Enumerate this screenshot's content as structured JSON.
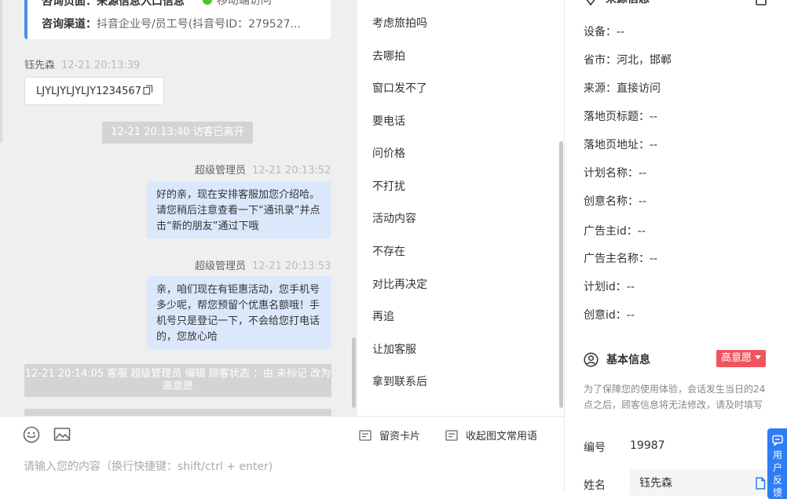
{
  "chat": {
    "info_card": {
      "row1_text": "咨询页面：来源信息入口信息",
      "status_text": "移动端访问",
      "channel_label": "咨询渠道：",
      "channel_value": "抖音企业号/员工号(抖音号ID：279527..."
    },
    "visitor": {
      "name": "钰先森",
      "time": "12-21 20:13:39",
      "message": "LJYLJYLJYLJY1234567"
    },
    "system_left": "12-21 20:13:40 访客已离开",
    "agent_messages": [
      {
        "name": "超级管理员",
        "time": "12-21 20:13:52",
        "text": "好的亲，现在安排客服加您介绍哈。请您稍后注意查看一下“通讯录”并点击“新的朋友”通过下哦"
      },
      {
        "name": "超级管理员",
        "time": "12-21 20:13:53",
        "text": "亲，咱们现在有钜惠活动，您手机号多少呢，帮您预留个优惠名额哦！手机号只是登记一下，不会给您打电话的，您放心哈"
      }
    ],
    "system_status": "12-21 20:14:05 客服 超级管理员 编辑 顾客状态 ：由 未标记 改为 高意愿"
  },
  "composer": {
    "tool_lead_card": "留资卡片",
    "tool_collapse": "收起图文常用语",
    "placeholder": "请输入您的内容（换行快捷键：shift/ctrl + enter)"
  },
  "quick_replies": [
    "考虑旅拍吗",
    "去哪拍",
    "窗口发不了",
    "要电话",
    "问价格",
    "不打扰",
    "活动内容",
    "不存在",
    "对比再决定",
    "再追",
    "让加客服",
    "拿到联系后"
  ],
  "side": {
    "source_title": "来源信息",
    "source_rows": [
      "设备：--",
      "省市：河北，邯郸",
      "来源：直接访问",
      "落地页标题：--",
      "落地页地址：--",
      "计划名称：--",
      "创意名称：--",
      "广告主id：--",
      "广告主名称：--",
      "计划id：--",
      "创意id：--"
    ],
    "basic_title": "基本信息",
    "intent_tag": "高意愿",
    "note": "为了保障您的使用体验，会话发生当日的24点之后，顾客信息将无法修改，请及时填写",
    "id_label": "编号",
    "id_value": "19987",
    "name_label": "姓名",
    "name_value": "钰先森",
    "float_label": "用户反馈"
  },
  "colors": {
    "accent": "#4a90e2",
    "agent_bubble": "#dbe8fb",
    "intent_tag": "#f0555d",
    "float_button": "#2f7df6",
    "online_dot": "#52c41a"
  }
}
